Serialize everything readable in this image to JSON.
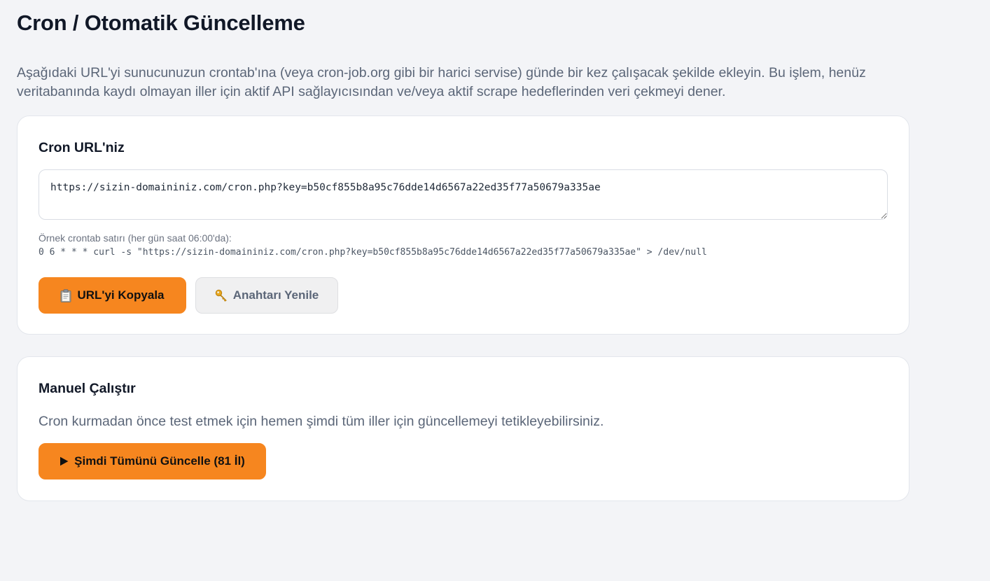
{
  "page": {
    "title": "Cron / Otomatik Güncelleme",
    "intro": "Aşağıdaki URL'yi sunucunuzun crontab'ına (veya cron-job.org gibi bir harici servise) günde bir kez çalışacak şekilde ekleyin. Bu işlem, henüz veritabanında kaydı olmayan iller için aktif API sağlayıcısından ve/veya aktif scrape hedeflerinden veri çekmeyi dener."
  },
  "cron_card": {
    "title": "Cron URL'niz",
    "url_value": "https://sizin-domaininiz.com/cron.php?key=b50cf855b8a95c76dde14d6567a22ed35f77a50679a335ae",
    "example_label": "Örnek crontab satırı (her gün saat 06:00'da):",
    "example_code": "0 6 * * * curl -s \"https://sizin-domaininiz.com/cron.php?key=b50cf855b8a95c76dde14d6567a22ed35f77a50679a335ae\" > /dev/null",
    "copy_button": "URL'yi Kopyala",
    "renew_button": "Anahtarı Yenile"
  },
  "manual_card": {
    "title": "Manuel Çalıştır",
    "description": "Cron kurmadan önce test etmek için hemen şimdi tüm iller için güncellemeyi tetikleyebilirsiniz.",
    "run_button": "Şimdi Tümünü Güncelle (81 İl)"
  },
  "colors": {
    "accent": "#f6861f",
    "background": "#f3f4f7",
    "card": "#ffffff",
    "muted_text": "#5b6678"
  },
  "icons": {
    "copy": "clipboard-icon",
    "renew": "key-icon",
    "run": "play-icon"
  }
}
